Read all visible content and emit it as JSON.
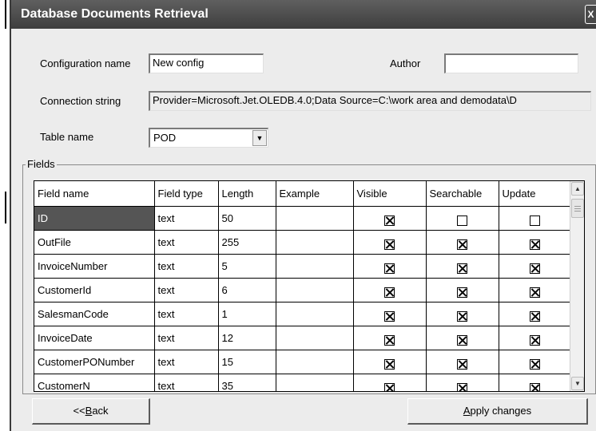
{
  "window": {
    "title": "Database Documents Retrieval",
    "close_glyph": "X"
  },
  "form": {
    "config_label": "Configuration name",
    "config_value": "New config",
    "author_label": "Author",
    "author_value": "",
    "conn_label": "Connection string",
    "conn_value": "Provider=Microsoft.Jet.OLEDB.4.0;Data Source=C:\\work area and demodata\\D",
    "table_label": "Table name",
    "table_value": "POD"
  },
  "fields_group": {
    "legend": "Fields",
    "columns": [
      "Field name",
      "Field type",
      "Length",
      "Example",
      "Visible",
      "Searchable",
      "Update"
    ],
    "rows": [
      {
        "name": "ID",
        "type": "text",
        "length": "50",
        "example": "",
        "visible": true,
        "searchable": false,
        "update": false
      },
      {
        "name": "OutFile",
        "type": "text",
        "length": "255",
        "example": "",
        "visible": true,
        "searchable": true,
        "update": true
      },
      {
        "name": "InvoiceNumber",
        "type": "text",
        "length": "5",
        "example": "",
        "visible": true,
        "searchable": true,
        "update": true
      },
      {
        "name": "CustomerId",
        "type": "text",
        "length": "6",
        "example": "",
        "visible": true,
        "searchable": true,
        "update": true
      },
      {
        "name": "SalesmanCode",
        "type": "text",
        "length": "1",
        "example": "",
        "visible": true,
        "searchable": true,
        "update": true
      },
      {
        "name": "InvoiceDate",
        "type": "text",
        "length": "12",
        "example": "",
        "visible": true,
        "searchable": true,
        "update": true
      },
      {
        "name": "CustomerPONumber",
        "type": "text",
        "length": "15",
        "example": "",
        "visible": true,
        "searchable": true,
        "update": true
      },
      {
        "name": "CustomerN",
        "type": "text",
        "length": "35",
        "example": "",
        "visible": true,
        "searchable": true,
        "update": true
      }
    ]
  },
  "buttons": {
    "back_prefix": "<<",
    "back_mnemonic": "B",
    "back_rest": "ack",
    "apply_mnemonic": "A",
    "apply_rest": "pply changes"
  },
  "scrollbar": {
    "up_glyph": "▲",
    "down_glyph": "▼"
  }
}
